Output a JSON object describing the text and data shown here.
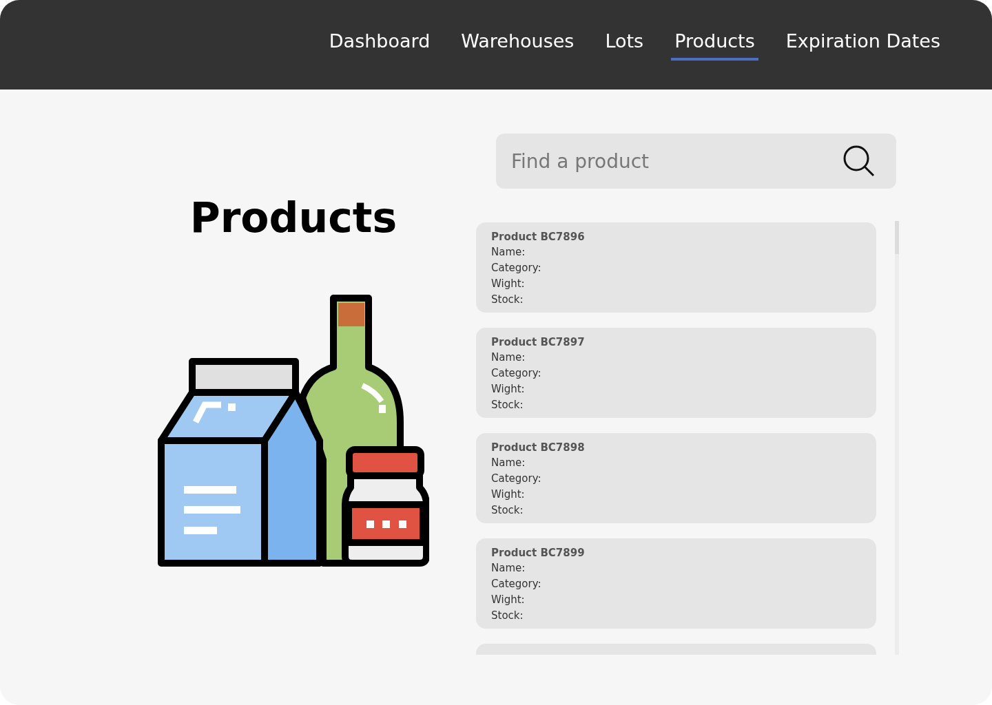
{
  "nav": [
    {
      "label": "Dashboard",
      "selected": false
    },
    {
      "label": "Warehouses",
      "selected": false
    },
    {
      "label": "Lots",
      "selected": false
    },
    {
      "label": "Products",
      "selected": true
    },
    {
      "label": "Expiration Dates",
      "selected": false
    }
  ],
  "page_title": "Products",
  "search": {
    "placeholder": "Find a product"
  },
  "products": [
    {
      "kind": "card",
      "title": "Product BC7896",
      "fields": [
        "Name:",
        "Category:",
        "Wight:",
        "Stock:"
      ]
    },
    {
      "kind": "card",
      "title": "Product BC7897",
      "fields": [
        "Name:",
        "Category:",
        "Wight:",
        "Stock:"
      ]
    },
    {
      "kind": "card",
      "title": "Product BC7898",
      "fields": [
        "Name:",
        "Category:",
        "Wight:",
        "Stock:"
      ]
    },
    {
      "kind": "card",
      "title": "Product BC7899",
      "fields": [
        "Name:",
        "Category:",
        "Wight:",
        "Stock:"
      ]
    },
    {
      "kind": "clipped"
    }
  ]
}
